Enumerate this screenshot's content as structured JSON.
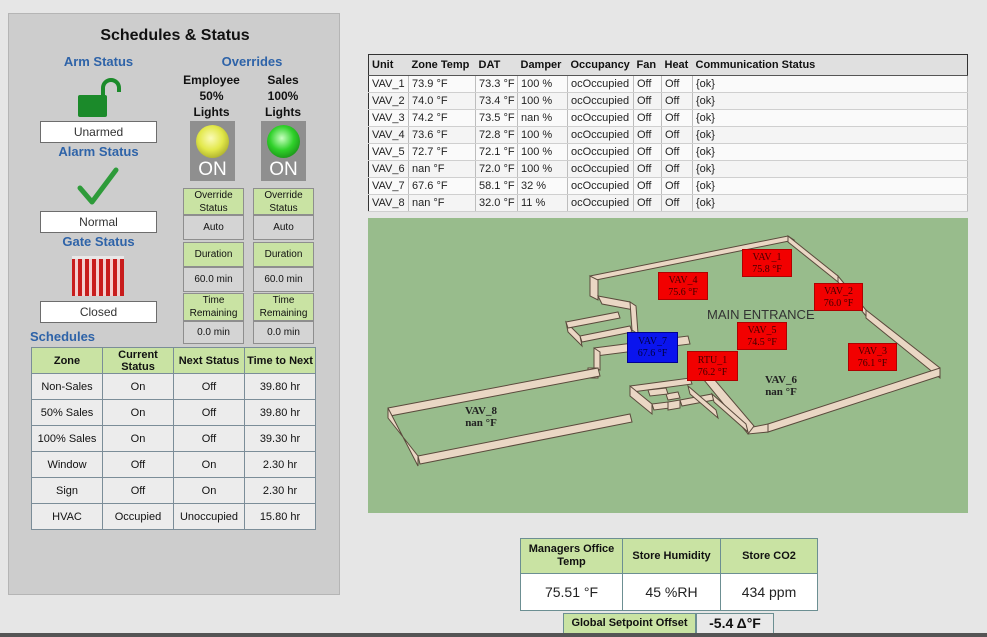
{
  "panel": {
    "title": "Schedules & Status",
    "arm_status": {
      "heading": "Arm Status",
      "value": "Unarmed",
      "icon": "unlocked-padlock-icon"
    },
    "alarm_status": {
      "heading": "Alarm Status",
      "value": "Normal",
      "icon": "checkmark-icon"
    },
    "gate_status": {
      "heading": "Gate Status",
      "value": "Closed",
      "icon": "gate-icon"
    },
    "overrides": {
      "heading": "Overrides",
      "employee": {
        "line1": "Employee",
        "line2": "50%",
        "line3": "Lights",
        "light": "ON",
        "status_label": "Override Status",
        "status_value": "Auto",
        "duration_label": "Duration",
        "duration_value": "60.0 min",
        "remaining_label": "Time Remaining",
        "remaining_value": "0.0 min",
        "light_color": "#e2e84a"
      },
      "sales": {
        "line1": "Sales",
        "line2": "100%",
        "line3": "Lights",
        "light": "ON",
        "status_label": "Override Status",
        "status_value": "Auto",
        "duration_label": "Duration",
        "duration_value": "60.0 min",
        "remaining_label": "Time Remaining",
        "remaining_value": "0.0 min",
        "light_color": "#2fd12a"
      }
    },
    "schedules": {
      "heading": "Schedules",
      "columns": [
        "Zone",
        "Current Status",
        "Next Status",
        "Time to Next"
      ],
      "rows": [
        [
          "Non-Sales",
          "On",
          "Off",
          "39.80 hr"
        ],
        [
          "50% Sales",
          "On",
          "Off",
          "39.80 hr"
        ],
        [
          "100% Sales",
          "On",
          "Off",
          "39.30 hr"
        ],
        [
          "Window",
          "Off",
          "On",
          "2.30 hr"
        ],
        [
          "Sign",
          "Off",
          "On",
          "2.30 hr"
        ],
        [
          "HVAC",
          "Occupied",
          "Unoccupied",
          "15.80 hr"
        ]
      ]
    }
  },
  "units": {
    "columns": [
      "Unit",
      "Zone Temp",
      "DAT",
      "Damper",
      "Occupancy",
      "Fan",
      "Heat",
      "Communication Status"
    ],
    "rows": [
      [
        "VAV_1",
        "73.9 °F",
        "73.3 °F",
        "100 %",
        "ocOccupied",
        "Off",
        "Off",
        "{ok}"
      ],
      [
        "VAV_2",
        "74.0 °F",
        "73.4 °F",
        "100 %",
        "ocOccupied",
        "Off",
        "Off",
        "{ok}"
      ],
      [
        "VAV_3",
        "74.2 °F",
        "73.5 °F",
        "nan %",
        "ocOccupied",
        "Off",
        "Off",
        "{ok}"
      ],
      [
        "VAV_4",
        "73.6 °F",
        "72.8 °F",
        "100 %",
        "ocOccupied",
        "Off",
        "Off",
        "{ok}"
      ],
      [
        "VAV_5",
        "72.7 °F",
        "72.1 °F",
        "100 %",
        "ocOccupied",
        "Off",
        "Off",
        "{ok}"
      ],
      [
        "VAV_6",
        "nan °F",
        "72.0 °F",
        "100 %",
        "ocOccupied",
        "Off",
        "Off",
        "{ok}"
      ],
      [
        "VAV_7",
        "67.6 °F",
        "58.1 °F",
        "32 %",
        "ocOccupied",
        "Off",
        "Off",
        "{ok}"
      ],
      [
        "VAV_8",
        "nan °F",
        "32.0 °F",
        "11 %",
        "ocOccupied",
        "Off",
        "Off",
        "{ok}"
      ]
    ]
  },
  "floorplan": {
    "entrance_label": "MAIN ENTRANCE",
    "zones": [
      {
        "name": "VAV_1",
        "temp": "75.8 °F",
        "style": "red"
      },
      {
        "name": "VAV_2",
        "temp": "76.0 °F",
        "style": "red"
      },
      {
        "name": "VAV_3",
        "temp": "76.1 °F",
        "style": "red"
      },
      {
        "name": "VAV_4",
        "temp": "75.6 °F",
        "style": "red"
      },
      {
        "name": "VAV_5",
        "temp": "74.5 °F",
        "style": "red"
      },
      {
        "name": "VAV_7",
        "temp": "67.6 °F",
        "style": "blue"
      },
      {
        "name": "RTU_1",
        "temp": "76.2 °F",
        "style": "red"
      },
      {
        "name": "VAV_6",
        "temp": "nan °F",
        "style": "plain"
      },
      {
        "name": "VAV_8",
        "temp": "nan °F",
        "style": "plain"
      }
    ]
  },
  "kpis": {
    "columns": [
      "Managers Office Temp",
      "Store Humidity",
      "Store CO2"
    ],
    "values": [
      "75.51 °F",
      "45 %RH",
      "434 ppm"
    ],
    "offset_label": "Global Setpoint Offset",
    "offset_value": "-5.4 Δ°F"
  }
}
